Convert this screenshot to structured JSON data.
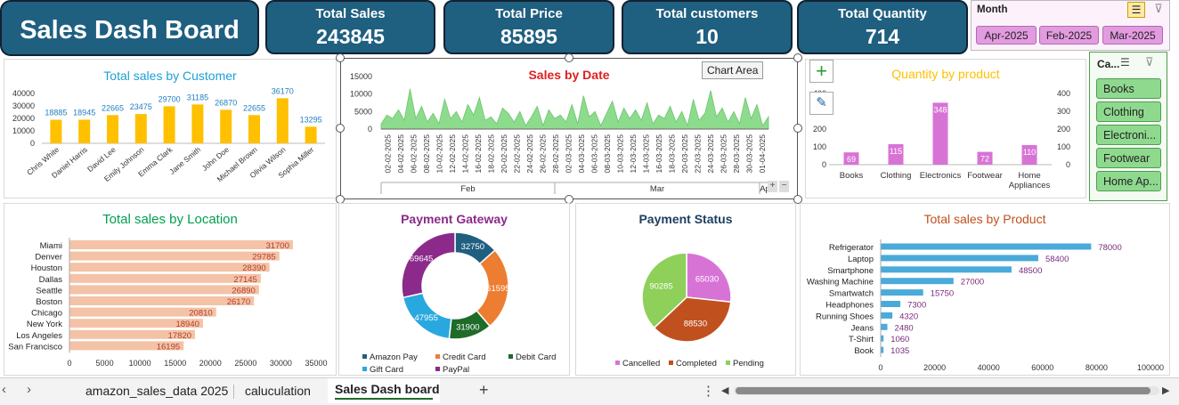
{
  "dashboard": {
    "title": "Sales Dash Board"
  },
  "kpis": [
    {
      "label": "Total Sales",
      "value": "243845"
    },
    {
      "label": "Total Price",
      "value": "85895"
    },
    {
      "label": "Total customers",
      "value": "10"
    },
    {
      "label": "Total Quantity",
      "value": "714"
    }
  ],
  "month_slicer": {
    "title": "Month",
    "options": [
      "Apr-2025",
      "Feb-2025",
      "Mar-2025"
    ]
  },
  "category_slicer": {
    "title": "Ca...",
    "options": [
      "Books",
      "Clothing",
      "Electroni...",
      "Footwear",
      "Home Ap..."
    ]
  },
  "tooltip": {
    "text": "Chart Area"
  },
  "sheet_tabs": [
    "amazon_sales_data 2025",
    "caluculation",
    "Sales Dash board"
  ],
  "active_tab": "Sales Dash board",
  "colors": {
    "navy": "#1f5f80",
    "gold": "#ffc000",
    "green": "#8ddc8d",
    "pink": "#d873d6",
    "salmon": "#f4c2a6",
    "blue": "#4aaad9",
    "accent_green": "#00b050",
    "red": "#e02020"
  },
  "chart_data": [
    {
      "type": "bar",
      "title": "Total sales by Customer",
      "categories": [
        "Chris White",
        "Daniel Harris",
        "David Lee",
        "Emily Johnson",
        "Emma Clark",
        "Jane Smith",
        "John Doe",
        "Michael Brown",
        "Olivia Wilson",
        "Sophia Miller"
      ],
      "values": [
        18885,
        18945,
        22665,
        23475,
        29700,
        31185,
        26870,
        22655,
        36170,
        13295
      ],
      "yticks": [
        "0",
        "10000",
        "20000",
        "30000",
        "40000"
      ],
      "ylim": [
        0,
        40000
      ],
      "grid": false
    },
    {
      "type": "area",
      "title": "Sales by Date",
      "yticks": [
        "0",
        "5000",
        "10000",
        "15000"
      ],
      "ylim": [
        0,
        15000
      ],
      "dates": [
        "02-02-2025",
        "04-02-2025",
        "06-02-2025",
        "08-02-2025",
        "10-02-2025",
        "12-02-2025",
        "14-02-2025",
        "16-02-2025",
        "18-02-2025",
        "20-02-2025",
        "22-02-2025",
        "24-02-2025",
        "26-02-2025",
        "28-02-2025",
        "02-03-2025",
        "04-03-2025",
        "06-03-2025",
        "08-03-2025",
        "10-03-2025",
        "12-03-2025",
        "14-03-2025",
        "16-03-2025",
        "18-03-2025",
        "20-03-2025",
        "22-03-2025",
        "24-03-2025",
        "26-03-2025",
        "28-03-2025",
        "30-03-2025",
        "01-04-2025"
      ],
      "months": [
        "Feb",
        "Mar",
        "Ap"
      ],
      "values": [
        1500,
        4000,
        3000,
        5500,
        2500,
        11500,
        3000,
        6500,
        2000,
        4500,
        1500,
        8500,
        3000,
        5000,
        2000,
        7000,
        4000,
        9000,
        2500,
        3500,
        1500,
        6000,
        4500,
        2000,
        5000,
        1000,
        3500,
        6500,
        1000,
        5500,
        3000,
        4000,
        2000,
        7000,
        1500,
        9500,
        3500,
        5000,
        1000,
        4500,
        8000,
        2000,
        6000,
        3000,
        5500,
        2500,
        7500,
        1500,
        4000,
        3000,
        6500,
        2000,
        5000,
        1000,
        8500,
        2500,
        4500,
        11000,
        3500,
        6000,
        2000,
        5000,
        1500,
        9000,
        3000,
        7000,
        1000,
        3500
      ]
    },
    {
      "type": "bar",
      "title": "Quantity by product",
      "categories": [
        "Books",
        "Clothing",
        "Electronics",
        "Footwear",
        "Home Appliances"
      ],
      "values": [
        69,
        115,
        348,
        72,
        110
      ],
      "yticks": [
        "0",
        "100",
        "200",
        "300",
        "400"
      ],
      "ylim": [
        0,
        400
      ]
    },
    {
      "type": "bar",
      "title": "Total sales by Location",
      "categories": [
        "Miami",
        "Denver",
        "Houston",
        "Dallas",
        "Seattle",
        "Boston",
        "Chicago",
        "New York",
        "Los Angeles",
        "San Francisco"
      ],
      "values": [
        31700,
        29785,
        28390,
        27145,
        26890,
        26170,
        20810,
        18940,
        17820,
        16195
      ],
      "xticks": [
        "0",
        "5000",
        "10000",
        "15000",
        "20000",
        "25000",
        "30000",
        "35000"
      ],
      "xlim": [
        0,
        35000
      ]
    },
    {
      "type": "pie",
      "title": "Payment Gateway",
      "labels": [
        "Amazon Pay",
        "Credit Card",
        "Debit Card",
        "Gift Card",
        "PayPal"
      ],
      "values": [
        32750,
        61595,
        31900,
        47955,
        69645
      ],
      "colors": [
        "#1f5f80",
        "#ed7d31",
        "#1e6b2a",
        "#29a8e0",
        "#8b2a8b"
      ]
    },
    {
      "type": "pie",
      "title": "Payment Status",
      "labels": [
        "Cancelled",
        "Completed",
        "Pending"
      ],
      "values": [
        65030,
        88530,
        90285
      ],
      "colors": [
        "#d873d6",
        "#c0501e",
        "#8ed05a"
      ]
    },
    {
      "type": "bar",
      "title": "Total sales by Product",
      "categories": [
        "Refrigerator",
        "Laptop",
        "Smartphone",
        "Washing Machine",
        "Smartwatch",
        "Headphones",
        "Running Shoes",
        "Jeans",
        "T-Shirt",
        "Book"
      ],
      "values": [
        78000,
        58400,
        48500,
        27000,
        15750,
        7300,
        4320,
        2480,
        1060,
        1035
      ],
      "xticks": [
        "0",
        "20000",
        "40000",
        "60000",
        "80000",
        "100000"
      ],
      "xlim": [
        0,
        100000
      ]
    }
  ]
}
